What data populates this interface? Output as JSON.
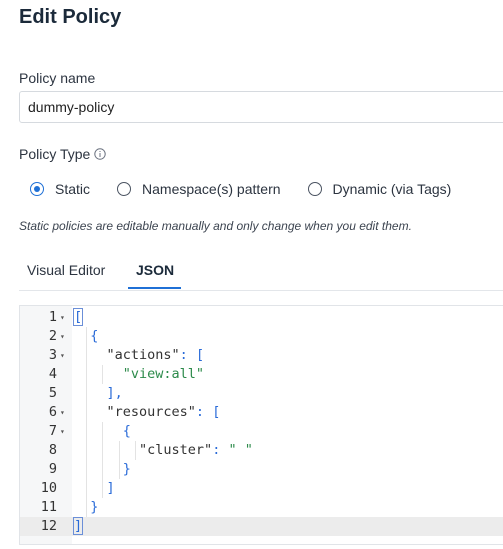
{
  "title": "Edit Policy",
  "policy_name": {
    "label": "Policy name",
    "value": "dummy-policy"
  },
  "policy_type": {
    "label": "Policy Type",
    "options": [
      {
        "label": "Static",
        "selected": true
      },
      {
        "label": "Namespace(s) pattern",
        "selected": false
      },
      {
        "label": "Dynamic (via Tags)",
        "selected": false
      }
    ],
    "hint": "Static policies are editable manually and only change when you edit them."
  },
  "tabs": [
    {
      "label": "Visual Editor",
      "active": false
    },
    {
      "label": "JSON",
      "active": true
    }
  ],
  "editor": {
    "lines": [
      {
        "n": "1",
        "fold": true,
        "text": "["
      },
      {
        "n": "2",
        "fold": true,
        "text": "  {"
      },
      {
        "n": "3",
        "fold": true,
        "text": "    \"actions\": ["
      },
      {
        "n": "4",
        "fold": false,
        "text": "      \"view:all\""
      },
      {
        "n": "5",
        "fold": false,
        "text": "    ],"
      },
      {
        "n": "6",
        "fold": true,
        "text": "    \"resources\": ["
      },
      {
        "n": "7",
        "fold": true,
        "text": "      {"
      },
      {
        "n": "8",
        "fold": false,
        "text": "        \"cluster\": \" \""
      },
      {
        "n": "9",
        "fold": false,
        "text": "      }"
      },
      {
        "n": "10",
        "fold": false,
        "text": "    ]"
      },
      {
        "n": "11",
        "fold": false,
        "text": "  }"
      },
      {
        "n": "12",
        "fold": false,
        "text": "]"
      }
    ]
  },
  "colors": {
    "accent": "#1f70d6",
    "string": "#2c8a4a",
    "punctuation": "#2a6bd8"
  }
}
